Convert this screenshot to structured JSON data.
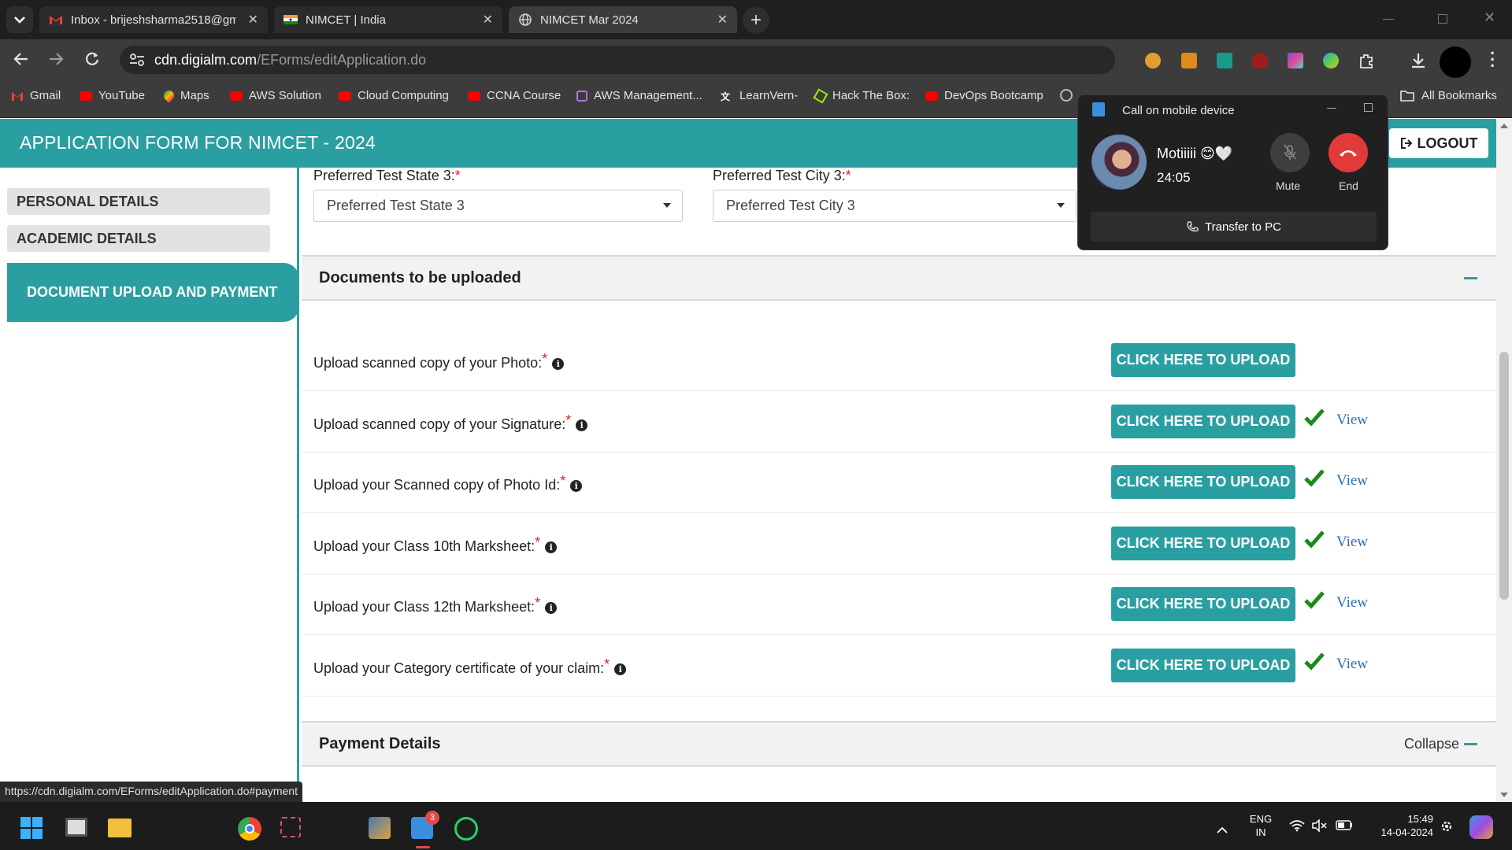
{
  "browser": {
    "tabs": [
      {
        "title": "Inbox - brijeshsharma2518@gm",
        "icon": "gmail-icon",
        "active": false
      },
      {
        "title": "NIMCET | India",
        "icon": "india-flag-icon",
        "active": false
      },
      {
        "title": "NIMCET Mar 2024",
        "icon": "globe-icon",
        "active": true
      }
    ],
    "url_host": "cdn.digialm.com",
    "url_path": "/EForms/editApplication.do",
    "bookmarks": [
      {
        "label": "Gmail",
        "icon": "gmail-icon"
      },
      {
        "label": "YouTube",
        "icon": "youtube-icon"
      },
      {
        "label": "Maps",
        "icon": "maps-icon"
      },
      {
        "label": "AWS Solution",
        "icon": "youtube-icon"
      },
      {
        "label": "Cloud Computing",
        "icon": "youtube-icon"
      },
      {
        "label": "CCNA Course",
        "icon": "youtube-icon"
      },
      {
        "label": "AWS Management...",
        "icon": "cube-icon"
      },
      {
        "label": "LearnVern-",
        "icon": "learnvern-icon"
      },
      {
        "label": "Hack The Box:",
        "icon": "htb-icon"
      },
      {
        "label": "DevOps Bootcamp",
        "icon": "youtube-icon"
      }
    ],
    "all_bookmarks": "All Bookmarks",
    "status_url": "https://cdn.digialm.com/EForms/editApplication.do#payment"
  },
  "page": {
    "title": "APPLICATION FORM FOR NIMCET - 2024",
    "logout": "LOGOUT",
    "sidebar": [
      "PERSONAL DETAILS",
      "ACADEMIC DETAILS",
      "DOCUMENT UPLOAD AND PAYMENT"
    ],
    "state_label": "Preferred Test State 3:",
    "state_value": "Preferred Test State 3",
    "city_label": "Preferred Test City 3:",
    "city_value": "Preferred Test City 3",
    "documents_heading": "Documents to be uploaded",
    "payment_heading": "Payment Details",
    "collapse": "Collapse",
    "upload_label": "CLICK HERE TO UPLOAD",
    "view_label": "View",
    "required_mark": "*",
    "info_glyph": "i",
    "documents": [
      {
        "label": "Upload scanned copy of your Photo:",
        "uploaded": false
      },
      {
        "label": "Upload scanned copy of your Signature:",
        "uploaded": true
      },
      {
        "label": "Upload your Scanned copy of Photo Id:",
        "uploaded": true
      },
      {
        "label": "Upload your Class 10th Marksheet:",
        "uploaded": true
      },
      {
        "label": "Upload your Class 12th Marksheet:",
        "uploaded": true
      },
      {
        "label": "Upload your Category certificate of your claim:",
        "uploaded": true
      }
    ]
  },
  "call_popup": {
    "title": "Call on mobile device",
    "caller": "Motiiiii 😊🤍",
    "duration": "24:05",
    "mute": "Mute",
    "end": "End",
    "transfer": "Transfer to PC"
  },
  "taskbar": {
    "badge": "3",
    "lang_top": "ENG",
    "lang_bottom": "IN",
    "time": "15:49",
    "date": "14-04-2024"
  },
  "colors": {
    "teal": "#2a9fa1",
    "required": "#e02020",
    "check": "#1a8a1a",
    "end_call": "#e03a3a",
    "link": "#2f6fb7"
  }
}
